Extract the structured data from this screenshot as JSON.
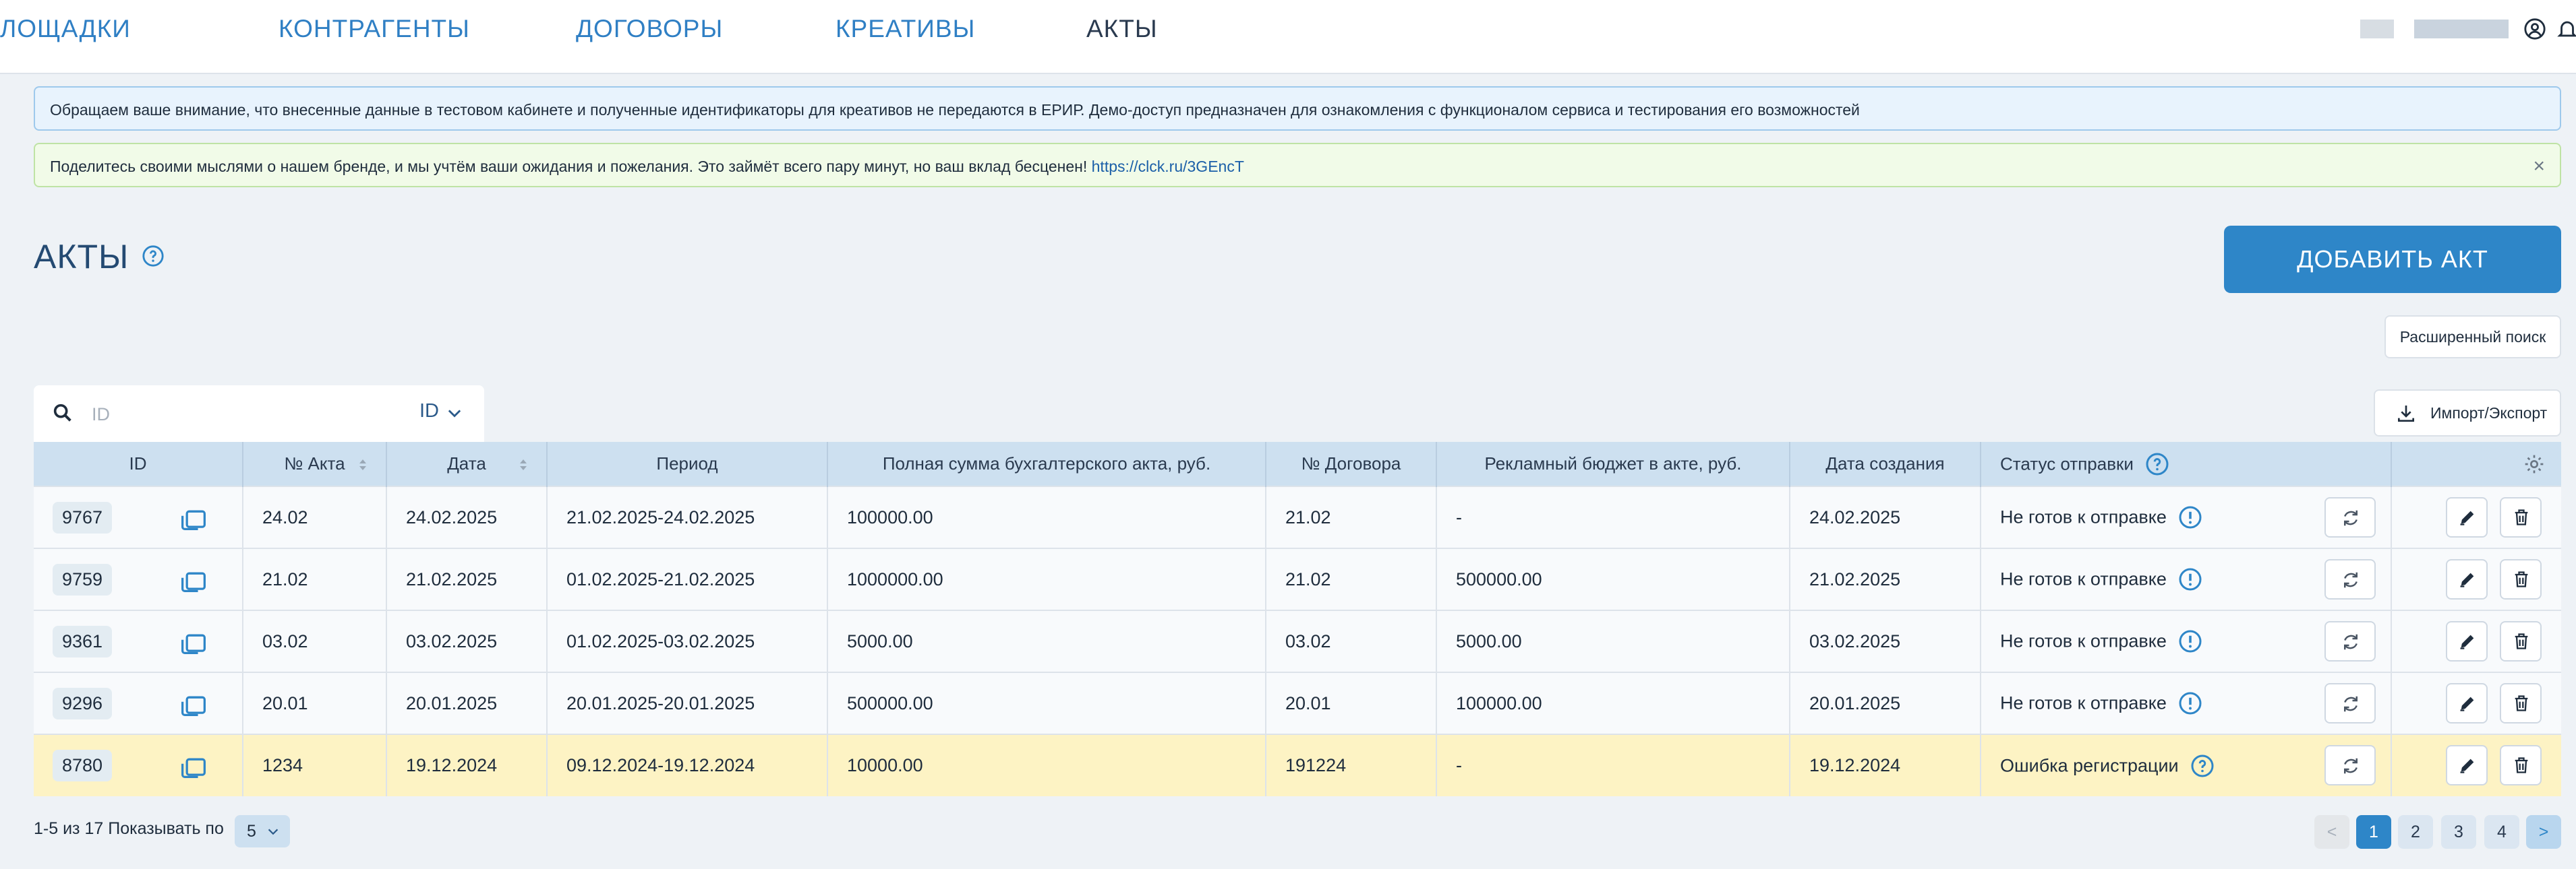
{
  "nav": {
    "items": [
      "ЛОЩАДКИ",
      "КОНТРАГЕНТЫ",
      "ДОГОВОРЫ",
      "КРЕАТИВЫ",
      "АКТЫ"
    ],
    "active": "АКТЫ"
  },
  "banners": {
    "info": "Обращаем ваше внимание, что внесенные данные в тестовом кабинете и полученные идентификаторы для креативов не передаются в ЕРИР. Демо-доступ предназначен для ознакомления с функционалом сервиса и тестирования его возможностей",
    "feedback": "Поделитесь своими мыслями о нашем бренде, и мы учтём ваши ожидания и пожелания. Это займёт всего пару минут, но ваш вклад бесценен! ",
    "feedback_link": "https://clck.ru/3GEncT",
    "close": "×"
  },
  "page": {
    "title": "АКТЫ",
    "add_button": "ДОБАВИТЬ АКТ",
    "advanced_search": "Расширенный поиск",
    "import_export": "Импорт/Экспорт"
  },
  "search": {
    "placeholder": "ID",
    "field": "ID"
  },
  "table": {
    "columns": [
      "ID",
      "№ Акта",
      "Дата",
      "Период",
      "Полная сумма бухгалтерского акта, руб.",
      "№ Договора",
      "Рекламный бюджет в акте, руб.",
      "Дата создания",
      "Статус отправки"
    ],
    "rows": [
      {
        "id": "9767",
        "act": "24.02",
        "date": "24.02.2025",
        "period": "21.02.2025-24.02.2025",
        "sum": "100000.00",
        "contract": "21.02",
        "budget": "-",
        "created": "24.02.2025",
        "status": "Не готов к отправке",
        "status_type": "info"
      },
      {
        "id": "9759",
        "act": "21.02",
        "date": "21.02.2025",
        "period": "01.02.2025-21.02.2025",
        "sum": "1000000.00",
        "contract": "21.02",
        "budget": "500000.00",
        "created": "21.02.2025",
        "status": "Не готов к отправке",
        "status_type": "info"
      },
      {
        "id": "9361",
        "act": "03.02",
        "date": "03.02.2025",
        "period": "01.02.2025-03.02.2025",
        "sum": "5000.00",
        "contract": "03.02",
        "budget": "5000.00",
        "created": "03.02.2025",
        "status": "Не готов к отправке",
        "status_type": "info"
      },
      {
        "id": "9296",
        "act": "20.01",
        "date": "20.01.2025",
        "period": "20.01.2025-20.01.2025",
        "sum": "500000.00",
        "contract": "20.01",
        "budget": "100000.00",
        "created": "20.01.2025",
        "status": "Не готов к отправке",
        "status_type": "info"
      },
      {
        "id": "8780",
        "act": "1234",
        "date": "19.12.2024",
        "period": "09.12.2024-19.12.2024",
        "sum": "10000.00",
        "contract": "191224",
        "budget": "-",
        "created": "19.12.2024",
        "status": "Ошибка регистрации",
        "status_type": "help"
      }
    ]
  },
  "pagination": {
    "info": "1-5 из 17",
    "per_page_label": "Показывать по",
    "per_page": "5",
    "pages": [
      "1",
      "2",
      "3",
      "4"
    ],
    "current": "1",
    "prev": "<",
    "next": ">"
  },
  "colors": {
    "accent": "#2e86c8",
    "header_bg": "#cde0f0",
    "warn_row": "#fdf3c4",
    "info_banner": "#e8f3fd",
    "ok_banner": "#f1fbe8"
  },
  "icons": [
    "user-circle-icon",
    "bell-icon",
    "help-icon",
    "search-icon",
    "chevron-down-icon",
    "download-icon",
    "sort-icon",
    "copy-icon",
    "info-icon",
    "refresh-icon",
    "edit-icon",
    "trash-icon",
    "gear-icon",
    "close-icon"
  ]
}
